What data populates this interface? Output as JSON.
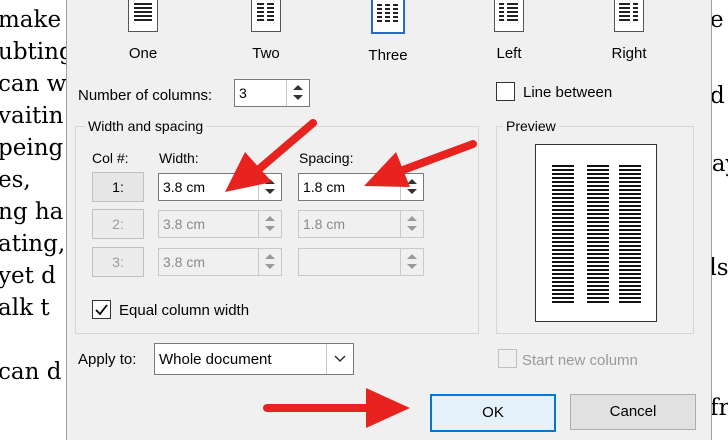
{
  "background_doc": {
    "left_lines": [
      "make",
      "ubting",
      "can w",
      "vaitin",
      "peing",
      "es,",
      "ng ha",
      "ating,",
      "yet d",
      "alk t",
      "",
      "can d"
    ],
    "right_lines": [
      "e",
      "d",
      "say",
      "ds",
      "fr"
    ]
  },
  "presets": {
    "one": "One",
    "two": "Two",
    "three": "Three",
    "left": "Left",
    "right": "Right"
  },
  "number_of_columns": {
    "label": "Number of columns:",
    "value": "3"
  },
  "line_between": {
    "label": "Line between",
    "checked": false
  },
  "width_spacing": {
    "title": "Width and spacing",
    "col_header": "Col #:",
    "width_header": "Width:",
    "spacing_header": "Spacing:",
    "rows": [
      {
        "col": "1:",
        "width": "3.8 cm",
        "spacing": "1.8 cm",
        "enabled": true
      },
      {
        "col": "2:",
        "width": "3.8 cm",
        "spacing": "1.8 cm",
        "enabled": false
      },
      {
        "col": "3:",
        "width": "3.8 cm",
        "spacing": "",
        "enabled": false
      }
    ]
  },
  "equal_column_width": {
    "label": "Equal column width",
    "checked": true
  },
  "preview": {
    "title": "Preview"
  },
  "apply_to": {
    "label": "Apply to:",
    "value": "Whole document"
  },
  "start_new_column": {
    "label": "Start new column",
    "checked": false
  },
  "buttons": {
    "ok": "OK",
    "cancel": "Cancel"
  },
  "colors": {
    "accent": "#0078d7",
    "annotation_arrow": "#e8231f"
  }
}
